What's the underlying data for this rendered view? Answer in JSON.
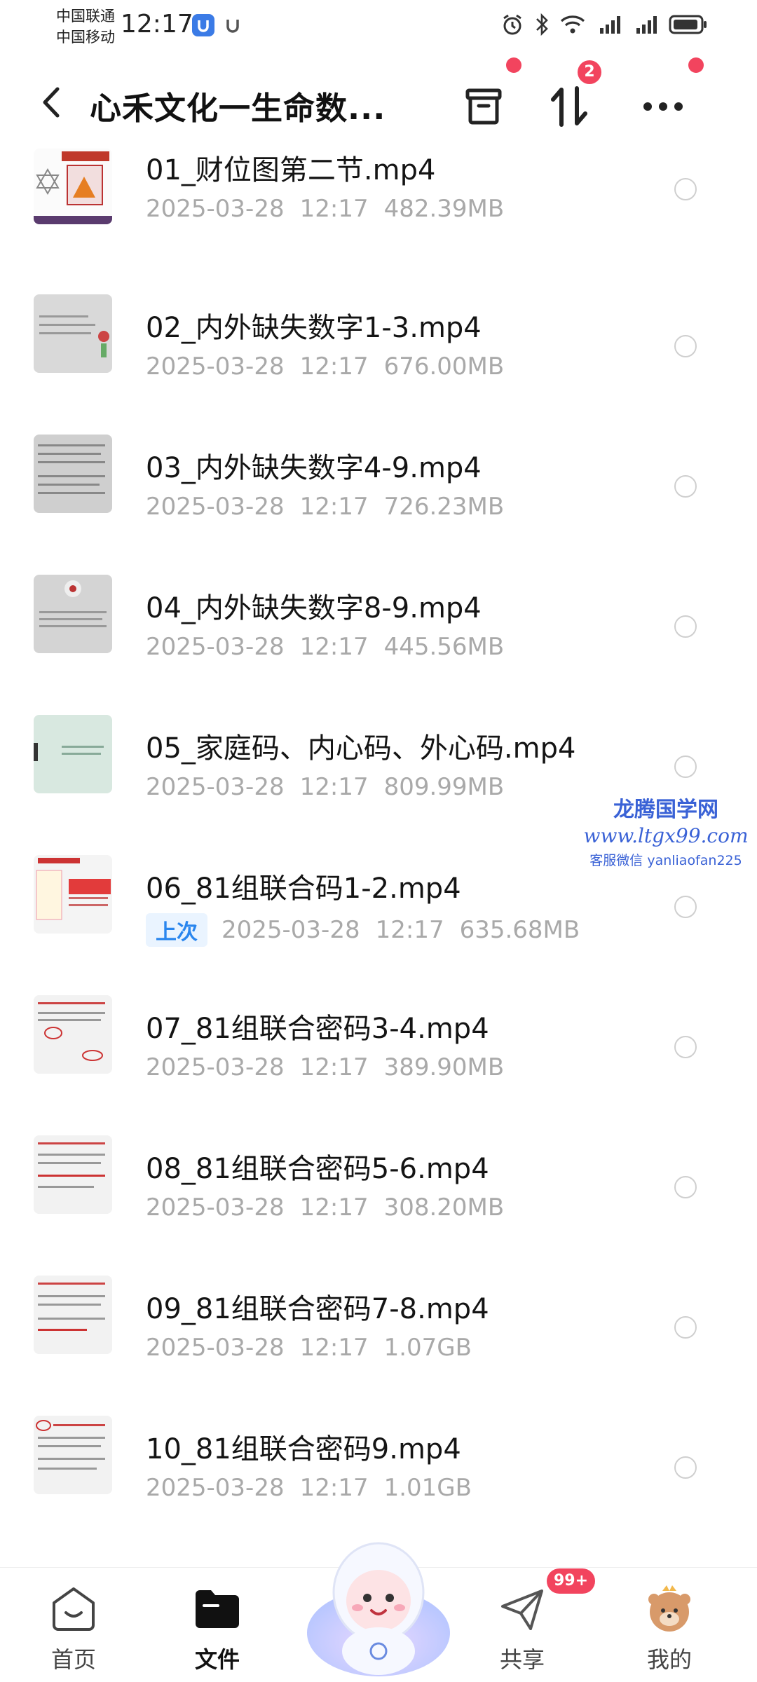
{
  "status_bar": {
    "carrier1": "中国联通",
    "carrier2": "中国移动",
    "time": "12:17"
  },
  "header": {
    "title": "心禾文化一生命数...",
    "transfer_badge": "2"
  },
  "files": [
    {
      "name": "01_财位图第二节.mp4",
      "date": "2025-03-28",
      "time": "12:17",
      "size": "482.39MB"
    },
    {
      "name": "02_内外缺失数字1-3.mp4",
      "date": "2025-03-28",
      "time": "12:17",
      "size": "676.00MB"
    },
    {
      "name": "03_内外缺失数字4-9.mp4",
      "date": "2025-03-28",
      "time": "12:17",
      "size": "726.23MB"
    },
    {
      "name": "04_内外缺失数字8-9.mp4",
      "date": "2025-03-28",
      "time": "12:17",
      "size": "445.56MB"
    },
    {
      "name": "05_家庭码、内心码、外心码.mp4",
      "date": "2025-03-28",
      "time": "12:17",
      "size": "809.99MB"
    },
    {
      "name": "06_81组联合码1-2.mp4",
      "tag": "上次",
      "date": "2025-03-28",
      "time": "12:17",
      "size": "635.68MB"
    },
    {
      "name": "07_81组联合密码3-4.mp4",
      "date": "2025-03-28",
      "time": "12:17",
      "size": "389.90MB"
    },
    {
      "name": "08_81组联合密码5-6.mp4",
      "date": "2025-03-28",
      "time": "12:17",
      "size": "308.20MB"
    },
    {
      "name": "09_81组联合密码7-8.mp4",
      "date": "2025-03-28",
      "time": "12:17",
      "size": "1.07GB"
    },
    {
      "name": "10_81组联合密码9.mp4",
      "date": "2025-03-28",
      "time": "12:17",
      "size": "1.01GB"
    }
  ],
  "watermark": {
    "line1": "龙腾国学网",
    "line2": "www.ltgx99.com",
    "line3": "客服微信 yanliaofan225"
  },
  "bottom_nav": {
    "home": "首页",
    "files": "文件",
    "share": "共享",
    "share_badge": "99+",
    "mine": "我的"
  },
  "icons": {
    "back": "chevron-left-icon",
    "archive": "archive-icon",
    "sort": "sort-arrows-icon",
    "more": "more-dots-icon"
  },
  "colors": {
    "accent_red": "#f2445e",
    "tag_blue": "#2a86ee",
    "meta_gray": "#a9a9a9"
  }
}
